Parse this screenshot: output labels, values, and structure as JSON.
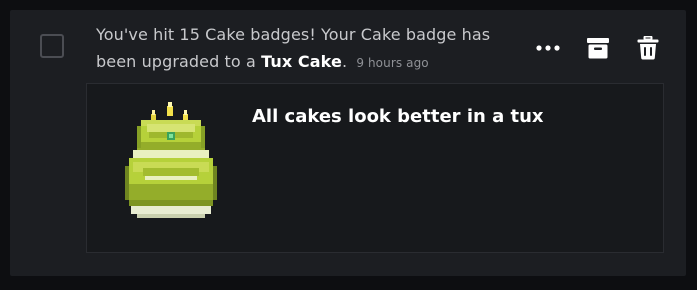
{
  "notification": {
    "text_before": "You've hit 15 Cake badges! Your Cake badge has been upgraded to a",
    "badge_name": "Tux Cake",
    "text_after": ".",
    "time": "9 hours ago"
  },
  "actions": {
    "more_icon": "more-horizontal-icon",
    "archive_icon": "archive-icon",
    "delete_icon": "trash-icon"
  },
  "badge": {
    "title": "All cakes look better in a tux",
    "image": "tux-cake-badge"
  },
  "colors": {
    "background": "#0d0e11",
    "card": "#1c1e22",
    "text": "#c8c9cc",
    "muted": "#8f9196",
    "cake_green": "#b6d13a"
  }
}
